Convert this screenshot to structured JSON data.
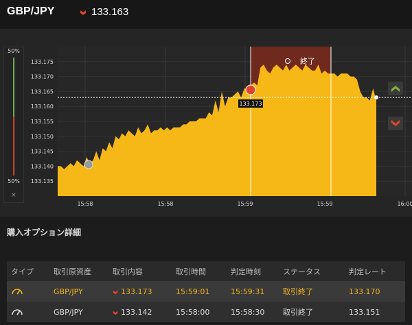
{
  "header": {
    "pair": "GBP/JPY",
    "rate": "133.163",
    "rate_direction": "down"
  },
  "gauge": {
    "top_label": "50%",
    "bottom_label": "50%",
    "close_symbol": "×"
  },
  "chart_data": {
    "type": "area",
    "series_color": "#f6b817",
    "current_rate": 133.163,
    "ylim": [
      133.13,
      133.18
    ],
    "y_ticks": [
      "133.175",
      "133.170",
      "133.165",
      "133.160",
      "133.155",
      "133.150",
      "133.145",
      "133.140",
      "133.135"
    ],
    "x_ticks": [
      "15:58",
      "15:58",
      "15:59",
      "15:59",
      "16:00"
    ],
    "entry_marker_label": "133.173",
    "closed_band_label": "終了",
    "y": [
      133.14,
      133.14,
      133.139,
      133.14,
      133.141,
      133.14,
      133.142,
      133.141,
      133.14,
      133.143,
      133.141,
      133.142,
      133.145,
      133.142,
      133.146,
      133.145,
      133.148,
      133.146,
      133.15,
      133.149,
      133.151,
      133.15,
      133.152,
      133.151,
      133.15,
      133.153,
      133.151,
      133.152,
      133.154,
      133.151,
      133.152,
      133.152,
      133.153,
      133.152,
      133.153,
      133.152,
      133.153,
      133.153,
      133.153,
      133.154,
      133.154,
      133.155,
      133.155,
      133.155,
      133.156,
      133.156,
      133.156,
      133.158,
      133.157,
      133.162,
      133.158,
      133.165,
      133.16,
      133.163,
      133.163,
      133.164,
      133.165,
      133.163,
      133.166,
      133.166,
      133.167,
      133.168,
      133.167,
      133.173,
      133.174,
      133.172,
      133.171,
      133.173,
      133.174,
      133.173,
      133.172,
      133.174,
      133.172,
      133.173,
      133.174,
      133.173,
      133.172,
      133.174,
      133.173,
      133.172,
      133.172,
      133.174,
      133.171,
      133.172,
      133.171,
      133.171,
      133.171,
      133.17,
      133.171,
      133.171,
      133.171,
      133.17,
      133.17,
      133.169,
      133.165,
      133.163,
      133.163,
      133.162,
      133.166,
      133.162
    ]
  },
  "options": {
    "title": "購入オプション詳細",
    "columns": [
      "タイプ",
      "取引原資産",
      "取引内容",
      "取引時間",
      "判定時刻",
      "ステータス",
      "判定レート"
    ],
    "rows": [
      {
        "asset": "GBP/JPY",
        "content": "133.173",
        "trade_time": "15:59:01",
        "judge_time": "15:59:31",
        "status": "取引終了",
        "judge_rate": "133.170"
      },
      {
        "asset": "GBP/JPY",
        "content": "133.142",
        "trade_time": "15:58:00",
        "judge_time": "15:58:30",
        "status": "取引終了",
        "judge_rate": "133.151"
      }
    ]
  }
}
